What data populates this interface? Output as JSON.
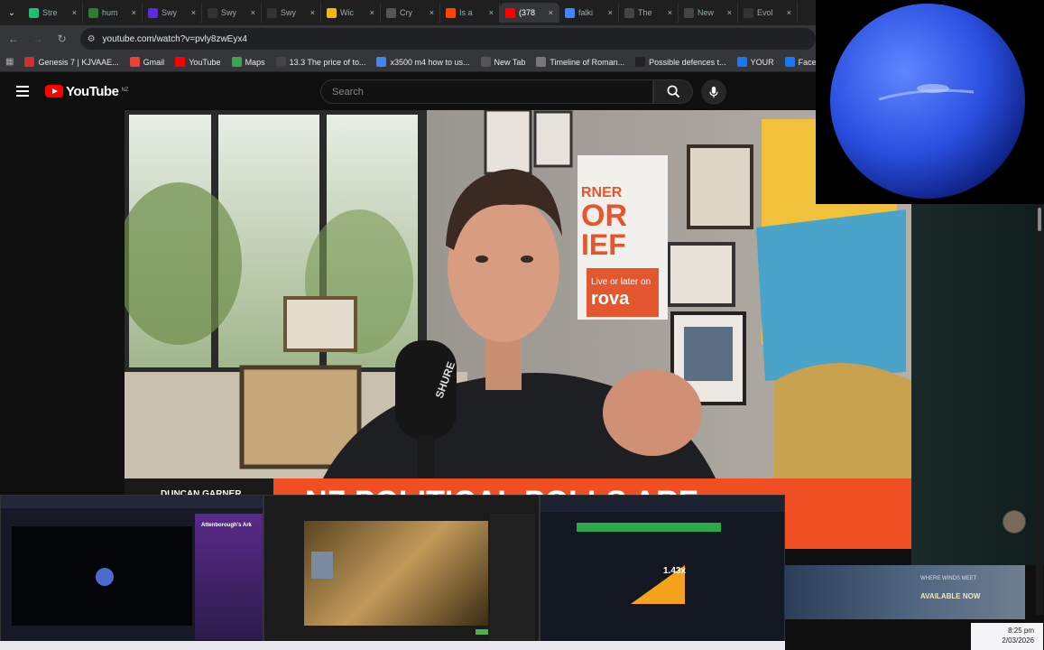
{
  "tabs": [
    {
      "title": "Stre",
      "color": "#1dbf73",
      "icon": "tab-favicon"
    },
    {
      "title": "hum",
      "color": "#2e7d32",
      "icon": "tab-favicon"
    },
    {
      "title": "Swy",
      "color": "#5b2bd9",
      "icon": "tab-favicon"
    },
    {
      "title": "Swy",
      "color": "#333333",
      "icon": "tab-favicon"
    },
    {
      "title": "Swy",
      "color": "#333333",
      "icon": "tab-favicon"
    },
    {
      "title": "Wic",
      "color": "#f0b90b",
      "icon": "tab-favicon"
    },
    {
      "title": "Cry",
      "color": "#555555",
      "icon": "tab-favicon"
    },
    {
      "title": "Is a",
      "color": "#ff4500",
      "icon": "tab-favicon"
    },
    {
      "title": "(378",
      "color": "#ff0000",
      "icon": "tab-favicon"
    },
    {
      "title": "falki",
      "color": "#4285f4",
      "icon": "tab-favicon"
    },
    {
      "title": "The",
      "color": "#444444",
      "icon": "tab-favicon"
    },
    {
      "title": "New",
      "color": "#444444",
      "icon": "tab-favicon"
    },
    {
      "title": "Evol",
      "color": "#333333",
      "icon": "tab-favicon"
    }
  ],
  "active_tab_index": 8,
  "address": {
    "url": "youtube.com/watch?v=pvly8zwEyx4"
  },
  "bookmarks": [
    {
      "label": "Genesis 7 | KJVAAE...",
      "color": "#d32f2f"
    },
    {
      "label": "Gmail",
      "color": "#ea4335"
    },
    {
      "label": "YouTube",
      "color": "#ff0000"
    },
    {
      "label": "Maps",
      "color": "#34a853"
    },
    {
      "label": "13.3 The price of to...",
      "color": "#444444"
    },
    {
      "label": "x3500 m4 how to us...",
      "color": "#4285f4"
    },
    {
      "label": "New Tab",
      "color": "#555555"
    },
    {
      "label": "Timeline of Roman...",
      "color": "#777777"
    },
    {
      "label": "Possible defences t...",
      "color": "#222222"
    },
    {
      "label": "YOUR",
      "color": "#1877f2"
    },
    {
      "label": "Facebook green",
      "color": "#1877f2"
    }
  ],
  "youtube": {
    "wordmark": "YouTube",
    "country": "NZ",
    "search_placeholder": "Search"
  },
  "video": {
    "banner_text": "NZ POLITICAL POLLS ARE",
    "banner_small": "DUNCAN GARNER",
    "poster_lines": [
      "RNER",
      "OR",
      "IEF"
    ],
    "poster_tag1": "Live or later on",
    "poster_tag2": "rova",
    "mic_brand": "SHURE"
  },
  "thumbs": {
    "t1_title": "Attenborough's Ark",
    "t3_value": "1.43x"
  },
  "ad": {
    "text": "AVAILABLE NOW",
    "brand": "WHERE WINDS MEET"
  },
  "clock": {
    "time": "8:25 pm",
    "date": "2/03/2026"
  }
}
